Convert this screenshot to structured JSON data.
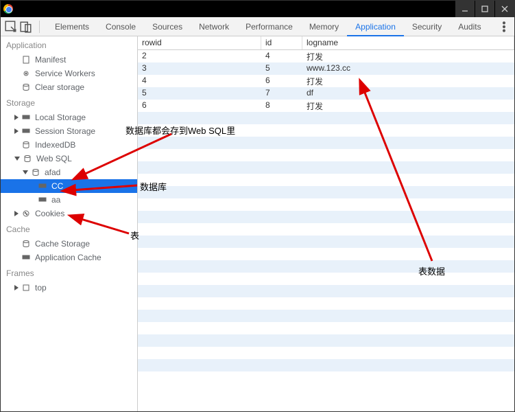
{
  "tabs": [
    "Elements",
    "Console",
    "Sources",
    "Network",
    "Performance",
    "Memory",
    "Application",
    "Security",
    "Audits"
  ],
  "active_tab": "Application",
  "sidebar": {
    "sections": [
      {
        "title": "Application",
        "items": [
          {
            "label": "Manifest",
            "icon": "doc",
            "level": 1
          },
          {
            "label": "Service Workers",
            "icon": "gear",
            "level": 1
          },
          {
            "label": "Clear storage",
            "icon": "db",
            "level": 1
          }
        ]
      },
      {
        "title": "Storage",
        "items": [
          {
            "label": "Local Storage",
            "icon": "grid",
            "level": 1,
            "tri": "closed"
          },
          {
            "label": "Session Storage",
            "icon": "grid",
            "level": 1,
            "tri": "closed"
          },
          {
            "label": "IndexedDB",
            "icon": "db",
            "level": 1
          },
          {
            "label": "Web SQL",
            "icon": "db",
            "level": 1,
            "tri": "open"
          },
          {
            "label": "afad",
            "icon": "db",
            "level": 2,
            "tri": "open"
          },
          {
            "label": "CC",
            "icon": "grid",
            "level": 3,
            "selected": true
          },
          {
            "label": "aa",
            "icon": "grid",
            "level": 3
          },
          {
            "label": "Cookies",
            "icon": "cookie",
            "level": 1,
            "tri": "closed"
          }
        ]
      },
      {
        "title": "Cache",
        "items": [
          {
            "label": "Cache Storage",
            "icon": "db",
            "level": 1
          },
          {
            "label": "Application Cache",
            "icon": "grid",
            "level": 1
          }
        ]
      },
      {
        "title": "Frames",
        "items": [
          {
            "label": "top",
            "icon": "box",
            "level": 1,
            "tri": "closed"
          }
        ]
      }
    ]
  },
  "grid": {
    "columns": [
      "rowid",
      "id",
      "logname"
    ],
    "rows": [
      [
        "2",
        "4",
        "打发"
      ],
      [
        "3",
        "5",
        "www.123.cc"
      ],
      [
        "4",
        "6",
        "打发"
      ],
      [
        "5",
        "7",
        "df"
      ],
      [
        "6",
        "8",
        "打发"
      ]
    ],
    "blank_rows": 22
  },
  "annotations": {
    "a1": "数据库都会存到Web SQL里",
    "a2": "数据库",
    "a3": "表",
    "a4": "表数据"
  }
}
